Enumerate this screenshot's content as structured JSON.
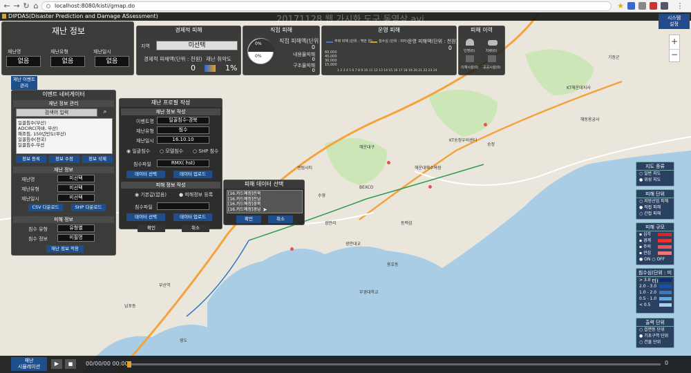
{
  "browser": {
    "url": "localhost:8080/kisti/gmap.do"
  },
  "app": {
    "title": "DIPDAS(Disaster Prediction and Damage ASsessment)",
    "overlay_title": "20171128 웹 가시화 도구 동영상.avi",
    "settings": "시스템\n설정"
  },
  "disaster_info": {
    "title": "재난 정보",
    "cols": [
      {
        "label": "재난명",
        "value": "없음"
      },
      {
        "label": "재난유형",
        "value": "없음"
      },
      {
        "label": "재난일시",
        "value": "없음"
      }
    ]
  },
  "econ": {
    "title": "경제적 피해",
    "region_label": "지역",
    "region_value": "미선택",
    "damage_label": "경제적 피해액(단위 : 천원)",
    "damage_value": "0",
    "index_label": "재난 취약도",
    "index_value": "1%"
  },
  "direct": {
    "title": "직접 피해",
    "sub": "직접 피해액(단위 : 천원)",
    "v1": "0",
    "l2": "내용물피해",
    "v2": "0",
    "l3": "구조물피해",
    "v3": "0",
    "pie1": "0%",
    "pie2": "0%"
  },
  "ops": {
    "title": "운영 피해",
    "legend": [
      "주택 피해 (단위 : 백만 원)",
      "침수심 (단위 : 미터)"
    ],
    "sub": "운영 피해액(단위 : 천원)",
    "value": "0",
    "yticks": [
      "60,000",
      "45,000",
      "30,000",
      "15,000"
    ],
    "xticks": "1 2 3 4 5 6 7 8 9 10 11 12 13 14 15 16 17 18 19 20 21 22 23 24"
  },
  "history": {
    "title": "피해 이력",
    "items": [
      "인명(0)",
      "차량(0)",
      "이재시설(0)",
      "공공시설(0)"
    ]
  },
  "event": {
    "side_tab": "재난 이벤트 관리",
    "nav_title": "이벤트 네비게이터",
    "mgmt": "재난 정보 관리",
    "search_placeholder": "검색어 입력",
    "list": [
      "일꼴침수(부산)",
      "ADCIRC(차바, 부산)",
      "해조침, 150년빈도(부산)",
      "일꼴침수(전국)",
      "일꼴침수-부선"
    ],
    "buttons": [
      "정보 등록",
      "정보 수정",
      "정보 삭제"
    ],
    "info_title": "재난 정보",
    "fields": [
      {
        "label": "재난명",
        "value": "미선택"
      },
      {
        "label": "재난유형",
        "value": "미선택"
      },
      {
        "label": "재난일시",
        "value": "미선택"
      }
    ],
    "csv": "CSV 다운로드",
    "shp": "SHP 다운로드",
    "dmg_title": "피해 정보",
    "dmg_fields": [
      {
        "label": "침수 유형",
        "value": "유형별"
      },
      {
        "label": "침수 정보",
        "value": "미필명"
      }
    ],
    "apply": "재난 정보 적용"
  },
  "profile": {
    "title": "재난 프로필 작성",
    "section": "재난 정보 작성",
    "rows": [
      {
        "label": "이벤트명",
        "value": "일꼴침수-경북"
      },
      {
        "label": "재난유형",
        "value": "침수"
      },
      {
        "label": "재난일시",
        "value": "16.10.10"
      }
    ],
    "radios": [
      "일괄침수",
      "모델침수",
      "SHP 침수"
    ],
    "file_label": "침수파일",
    "file_value": "RMX( hst)",
    "btn_select": "데이터 선택",
    "btn_upload": "데이터 업로드",
    "sec2": "피해 정보 작성",
    "radios2": [
      "기본값(없음)",
      "피해정보 등록"
    ],
    "file2": "침수파일",
    "confirm": "확인",
    "cancel": "취소"
  },
  "select_dialog": {
    "title": "피해 데이터 선택",
    "items": [
      "[16.카드예정]전북",
      "[16.카드예정]전남",
      "[16.카드예정]경북",
      "[16.카드예정]경남"
    ],
    "confirm": "확인",
    "cancel": "취소"
  },
  "right": {
    "map_type": {
      "title": "지도 종류",
      "items": [
        "일반 지도",
        "위성 지도"
      ]
    },
    "unit": {
      "title": "피해 단위",
      "items": [
        "지방산업 피해",
        "직접 피해",
        "간접 피해"
      ]
    },
    "scale": {
      "title": "피해 규모",
      "items": [
        "심각",
        "경계",
        "주의",
        "관심"
      ],
      "onoff": [
        "ON",
        "OFF"
      ]
    },
    "depth": {
      "title": "침수심(단위 : 미터)",
      "items": [
        "> 3.0",
        "2.0 - 3.0",
        "1.0 - 2.0",
        "0.5 - 1.0",
        "< 0.5"
      ]
    },
    "output": {
      "title": "출력 단위",
      "items": [
        "읍면동 단위",
        "기초구역 단위",
        "건물 단위"
      ]
    },
    "colors": {
      "scale": [
        "#d22",
        "#e33",
        "#e55",
        "#e77"
      ],
      "depth": [
        "#0a2a80",
        "#1a4ea8",
        "#3a78c0",
        "#6aa6d8",
        "#a8d0ec"
      ]
    }
  },
  "bottom": {
    "sim_label": "재난\n시뮬레이션",
    "time": "00/00/00 00:00",
    "counter": "0"
  },
  "map_labels": [
    "해운대구",
    "송정",
    "KT송정우비센터",
    "광안리",
    "BEXCO",
    "수영",
    "부산역",
    "영도",
    "남포동",
    "해운대해수욕장",
    "용호동",
    "KT해운대지사",
    "동백섬",
    "광안대교",
    "해동용궁사",
    "기장군",
    "센텀시티",
    "부경대학교"
  ],
  "colors": {
    "accent": "#1e4e8c",
    "panel": "#1e1e1e",
    "map_land": "#e9e4da",
    "sea": "#a9cce3"
  }
}
